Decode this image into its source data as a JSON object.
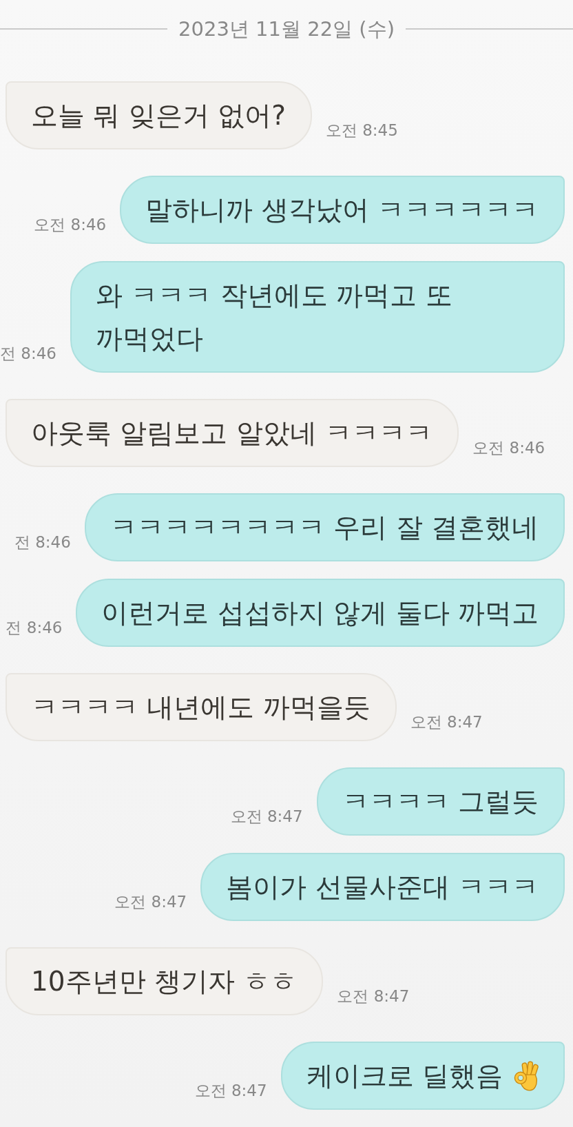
{
  "date_divider": {
    "label": "2023년 11월 22일 (수)"
  },
  "messages": [
    {
      "kind": "received",
      "text": "오늘 뭐 잊은거 없어?",
      "time": "오전 8:45"
    },
    {
      "kind": "sent",
      "text": "말하니까 생각났어 ㅋㅋㅋㅋㅋㅋ",
      "time": "오전 8:46"
    },
    {
      "kind": "sent",
      "text": "와 ㅋㅋㅋ 작년에도 까먹고 또 까먹었다",
      "time": "전 8:46"
    },
    {
      "kind": "received",
      "text": "아웃룩 알림보고 알았네 ㅋㅋㅋㅋ",
      "time": "오전 8:46"
    },
    {
      "kind": "sent",
      "text": "ㅋㅋㅋㅋㅋㅋㅋㅋ 우리 잘 결혼했네",
      "time": "전 8:46"
    },
    {
      "kind": "sent",
      "text": "이런거로 섭섭하지 않게 둘다 까먹고",
      "time": "전 8:46"
    },
    {
      "kind": "received",
      "text": "ㅋㅋㅋㅋ 내년에도 까먹을듯",
      "time": "오전 8:47"
    },
    {
      "kind": "sent",
      "text": "ㅋㅋㅋㅋ 그럴듯",
      "time": "오전 8:47"
    },
    {
      "kind": "sent",
      "text": "봄이가 선물사준대 ㅋㅋㅋ",
      "time": "오전 8:47"
    },
    {
      "kind": "received",
      "text": "10주년만 챙기자 ㅎㅎ",
      "time": "오전 8:47"
    },
    {
      "kind": "sent",
      "text": "케이크로 딜했음",
      "time": "오전 8:47",
      "emoji": true
    }
  ]
}
